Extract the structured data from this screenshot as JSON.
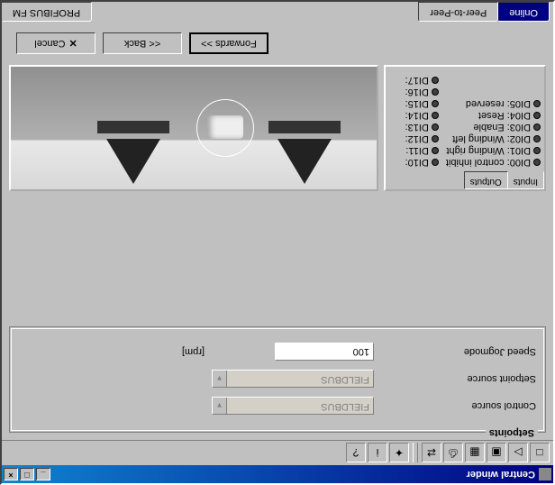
{
  "window": {
    "title": "Central winder"
  },
  "toolbar": {
    "icons": [
      "new",
      "open",
      "save",
      "saveall",
      "print",
      "transfer",
      "sep",
      "wizard",
      "info",
      "help"
    ]
  },
  "setpoints": {
    "title": "Setpoints",
    "control_label": "Control source",
    "control_value": "FIELDBUS",
    "setpoint_label": "Setpoint source",
    "setpoint_value": "FIELDBUS",
    "speed_label": "Speed Jogmode",
    "speed_value": "100",
    "speed_unit": "[rpm]"
  },
  "subtabs": {
    "inputs": "Inputs",
    "outputs": "Outputs"
  },
  "di_left": [
    {
      "id": "DI00",
      "label": "control inhibit"
    },
    {
      "id": "DI01",
      "label": "Winding right"
    },
    {
      "id": "DI02",
      "label": "Winding left"
    },
    {
      "id": "DI03",
      "label": "Enable"
    },
    {
      "id": "DI04",
      "label": "Reset"
    },
    {
      "id": "DI05",
      "label": "reserved"
    }
  ],
  "di_right": [
    {
      "id": "DI10",
      "label": ""
    },
    {
      "id": "DI11",
      "label": ""
    },
    {
      "id": "DI12",
      "label": ""
    },
    {
      "id": "DI13",
      "label": ""
    },
    {
      "id": "DI14",
      "label": ""
    },
    {
      "id": "DI15",
      "label": ""
    },
    {
      "id": "DI16",
      "label": ""
    },
    {
      "id": "DI17",
      "label": ""
    }
  ],
  "nav": {
    "forwards": "Forwards >>",
    "back": "<< Back",
    "cancel": "Cancel"
  },
  "tabs": {
    "online": "Online",
    "p2p": "Peer-to-Peer",
    "profibus": "PROFIBUS FM"
  }
}
